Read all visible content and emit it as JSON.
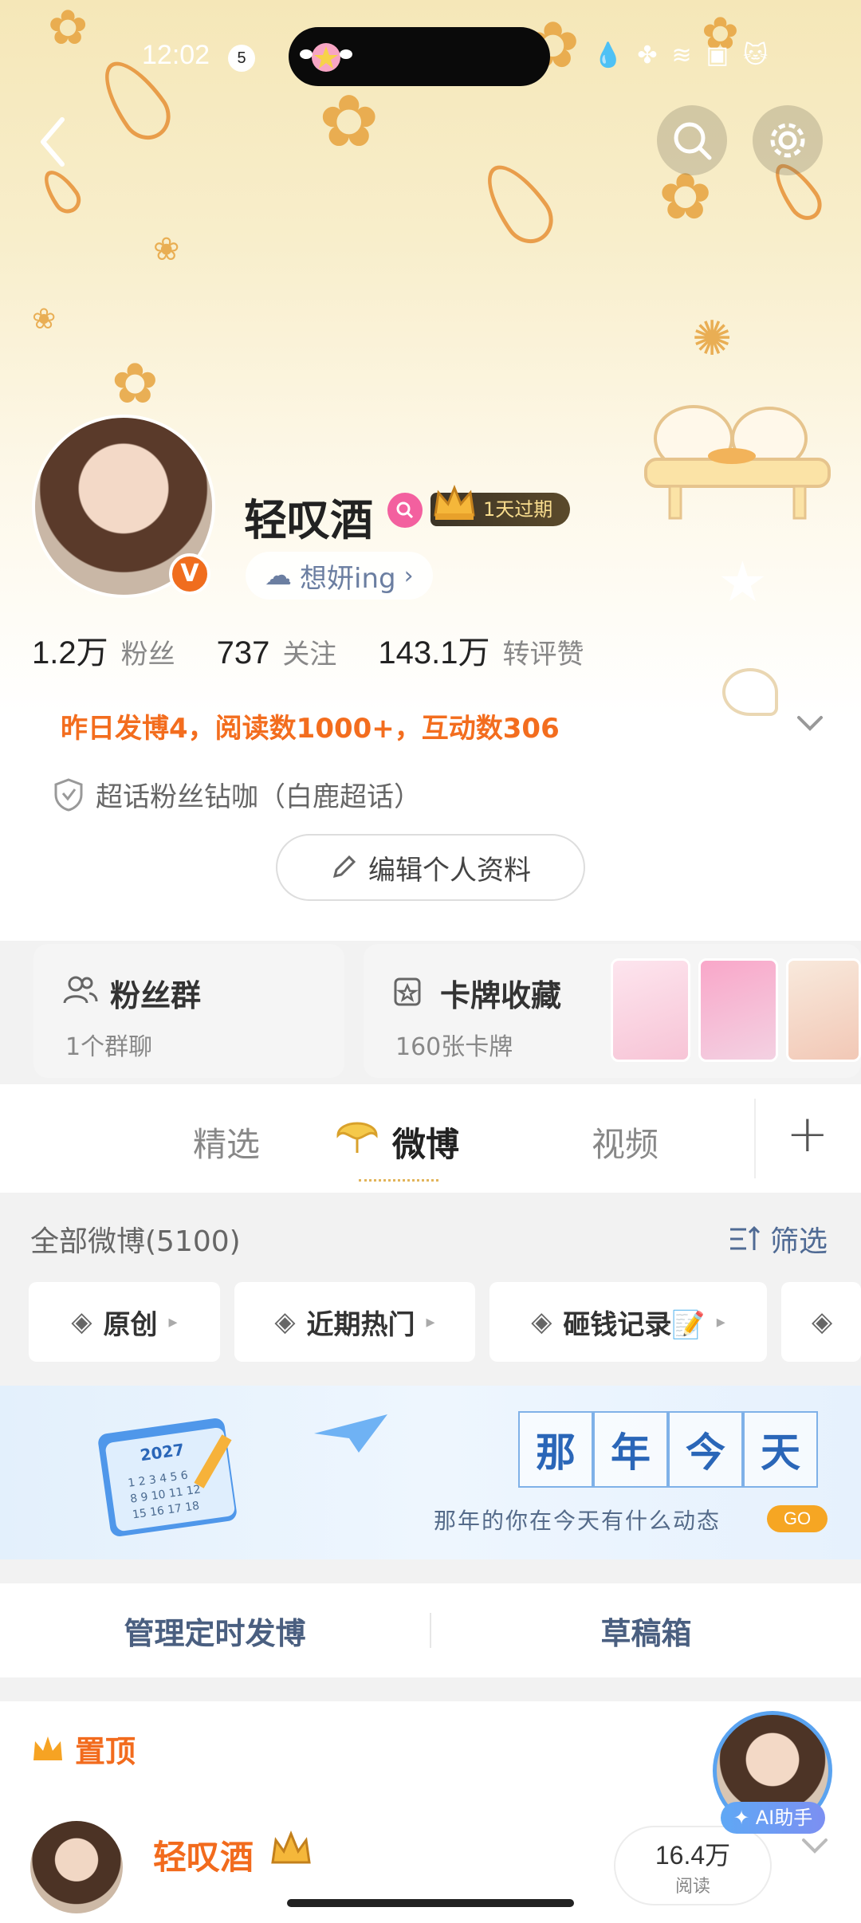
{
  "status_bar": {
    "time": "12:02",
    "notification_count": "5"
  },
  "profile": {
    "username": "轻叹酒",
    "vip_tag": "1天过期",
    "status": "想妍ing",
    "status_chevron": "›",
    "verified_mark": "V",
    "stats": [
      {
        "value": "1.2万",
        "label": "粉丝"
      },
      {
        "value": "737",
        "label": "关注"
      },
      {
        "value": "143.1万",
        "label": "转评赞"
      }
    ],
    "activity": "昨日发博4，阅读数1000+，互动数306",
    "fan_title": "超话粉丝钻咖（白鹿超话）",
    "edit_button": "编辑个人资料"
  },
  "cards": {
    "fan_group": {
      "title": "粉丝群",
      "sub": "1个群聊"
    },
    "card_collection": {
      "title": "卡牌收藏",
      "sub": "160张卡牌"
    }
  },
  "tabs": [
    {
      "label": "精选",
      "active": false
    },
    {
      "label": "微博",
      "active": true
    },
    {
      "label": "视频",
      "active": false
    }
  ],
  "tabs_add": "+",
  "feed": {
    "all_label": "全部微博(5100)",
    "filter_label": "筛选",
    "chips": [
      {
        "label": "原创"
      },
      {
        "label": "近期热门"
      },
      {
        "label": "砸钱记录📝"
      }
    ]
  },
  "banner": {
    "calendar_year": "2027",
    "chars": [
      "那",
      "年",
      "今",
      "天"
    ],
    "subtitle": "那年的你在今天有什么动态",
    "go": "GO"
  },
  "manage": {
    "scheduled": "管理定时发博",
    "drafts": "草稿箱"
  },
  "pinned": {
    "title": "置顶",
    "post_author": "轻叹酒",
    "read_value": "16.4万",
    "read_label": "阅读",
    "ai_label": "AI助手"
  },
  "colors": {
    "accent_orange": "#f26b1d",
    "link_blue": "#4f6a94",
    "vip_gold": "#f9dd8e"
  }
}
